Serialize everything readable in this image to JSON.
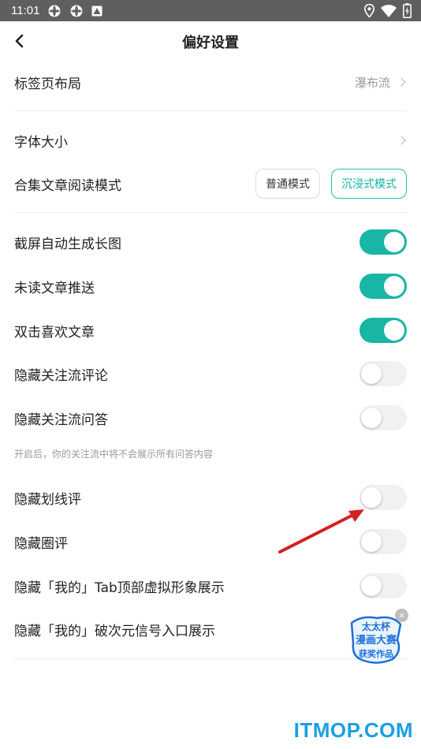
{
  "status_bar": {
    "time": "11:01",
    "left_icons": [
      "app-notification-icon",
      "app-notification-icon",
      "image-notification-icon"
    ],
    "right_icons": [
      "location-icon",
      "wifi-icon",
      "battery-icon"
    ]
  },
  "header": {
    "back_icon": "chevron-left-icon",
    "title": "偏好设置"
  },
  "settings": {
    "tab_layout": {
      "label": "标签页布局",
      "value": "瀑布流"
    },
    "font_size": {
      "label": "字体大小"
    },
    "collection_mode": {
      "label": "合集文章阅读模式",
      "options": [
        "普通模式",
        "沉浸式模式"
      ],
      "selected": "沉浸式模式"
    },
    "toggles": [
      {
        "label": "截屏自动生成长图",
        "on": true
      },
      {
        "label": "未读文章推送",
        "on": true
      },
      {
        "label": "双击喜欢文章",
        "on": true
      },
      {
        "label": "隐藏关注流评论",
        "on": false
      },
      {
        "label": "隐藏关注流问答",
        "on": false
      },
      {
        "label": "隐藏划线评",
        "on": false
      },
      {
        "label": "隐藏圈评",
        "on": false
      },
      {
        "label": "隐藏「我的」Tab顶部虚拟形象展示",
        "on": false
      },
      {
        "label": "隐藏「我的」破次元信号入口展示"
      }
    ],
    "qa_hint": "开启后，你的关注流中将不会展示所有问答内容"
  },
  "floating_badge": {
    "close_label": "×",
    "line1": "太太杯",
    "line2": "漫画大赛",
    "line3": "获奖作品"
  },
  "watermark": "ITMOP.COM",
  "colors": {
    "accent": "#19b5a5",
    "status_bar": "#5f5f5f",
    "annotation_arrow": "#d32020",
    "watermark": "#1aa0e4"
  }
}
